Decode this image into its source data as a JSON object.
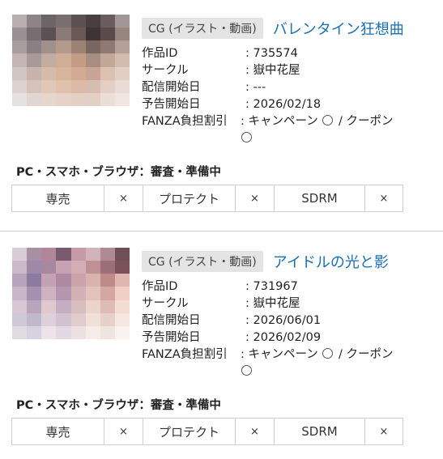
{
  "items": [
    {
      "category": "CG (イラスト・動画)",
      "title": "バレンタイン狂想曲",
      "fields": [
        {
          "label": "作品ID",
          "value": ": 735574"
        },
        {
          "label": "サークル",
          "value": ": 嶽中花屋"
        },
        {
          "label": "配信開始日",
          "value": ": ---"
        },
        {
          "label": "予告開始日",
          "value": ": 2026/02/18"
        }
      ],
      "burden_label": "FANZA負担割引",
      "burden_prefix": ": キャンペーン",
      "burden_sep": "/",
      "burden_coupon": "クーポン",
      "device_label": "PC・スマホ・ブラウザ：審査・準備中",
      "options": [
        {
          "label": "専売",
          "mark": "×"
        },
        {
          "label": "プロテクト",
          "mark": "×"
        },
        {
          "label": "SDRM",
          "mark": "×"
        }
      ]
    },
    {
      "category": "CG (イラスト・動画)",
      "title": "アイドルの光と影",
      "fields": [
        {
          "label": "作品ID",
          "value": ": 731967"
        },
        {
          "label": "サークル",
          "value": ": 嶽中花屋"
        },
        {
          "label": "配信開始日",
          "value": ": 2026/06/01"
        },
        {
          "label": "予告開始日",
          "value": ": 2026/02/09"
        }
      ],
      "burden_label": "FANZA負担割引",
      "burden_prefix": ": キャンペーン",
      "burden_sep": "/",
      "burden_coupon": "クーポン",
      "device_label": "PC・スマホ・ブラウザ：審査・準備中",
      "options": [
        {
          "label": "専売",
          "mark": "×"
        },
        {
          "label": "プロテクト",
          "mark": "×"
        },
        {
          "label": "SDRM",
          "mark": "×"
        }
      ]
    }
  ],
  "thumb_colors": [
    [
      "#b9aeb0",
      "#8e8487",
      "#6d6468",
      "#7a6e6f",
      "#5d5052",
      "#4a3e40",
      "#6b5d5d",
      "#a39696",
      "#9a8f92",
      "#786e72",
      "#5b5054",
      "#8a7a78",
      "#6a5854",
      "#3f3335",
      "#5a4a4a",
      "#96857f",
      "#a99e9f",
      "#8a7f82",
      "#a08f8a",
      "#b39a8c",
      "#9c8274",
      "#7a6660",
      "#8e7a72",
      "#b3a096",
      "#c4b6b4",
      "#a79a98",
      "#c2ab9f",
      "#cfae98",
      "#c49c86",
      "#a88d80",
      "#c2a898",
      "#d1bcae",
      "#d2c6c4",
      "#c8b4ac",
      "#d6bba8",
      "#d9b49c",
      "#d3ab95",
      "#c8a594",
      "#dcc1b2",
      "#e2cfc4",
      "#ddd2d0",
      "#d5c3bb",
      "#e0c8b8",
      "#dfc1ae",
      "#dbbba8",
      "#d6bdaf",
      "#e3cfc3",
      "#e9dcd4",
      "#e7e0e0",
      "#e1d6d2",
      "#e6d6cc",
      "#e6d2c6",
      "#e4cfc3",
      "#e2d0c6",
      "#ebded6",
      "#efe6e0"
    ],
    [
      "#d8cdd6",
      "#a98fa4",
      "#b2859a",
      "#7a5a6e",
      "#c79aa8",
      "#d1b4b8",
      "#b08a92",
      "#6e4f58",
      "#cbb8c8",
      "#9c8aa8",
      "#a688a0",
      "#c6a2b2",
      "#d4aeb4",
      "#bf9096",
      "#9c6e76",
      "#7a5258",
      "#b7a4bc",
      "#8d7aa0",
      "#c4a2b6",
      "#ad8aa2",
      "#cda2a8",
      "#d8b3b0",
      "#c08a88",
      "#e2b6b0",
      "#c9b6c8",
      "#a590b0",
      "#cfb2c2",
      "#b596ae",
      "#d3b0b4",
      "#e2c2bc",
      "#d4a8a2",
      "#f0cfc4",
      "#d8c8d4",
      "#b8a4bc",
      "#e0c8cf",
      "#c6aec2",
      "#d8bebc",
      "#ecd4cc",
      "#dcbcb4",
      "#f3dcd2",
      "#cfc8d6",
      "#c2b8cc",
      "#ddd0da",
      "#d2c2d0",
      "#e0cccc",
      "#f0e0d8",
      "#e6d0c8",
      "#f6e8e0",
      "#e0dce4",
      "#d8d2e0",
      "#ece4ea",
      "#e2d8e2",
      "#ece0e0",
      "#f6ecea",
      "#f0e4e0",
      "#faf2ee"
    ]
  ]
}
